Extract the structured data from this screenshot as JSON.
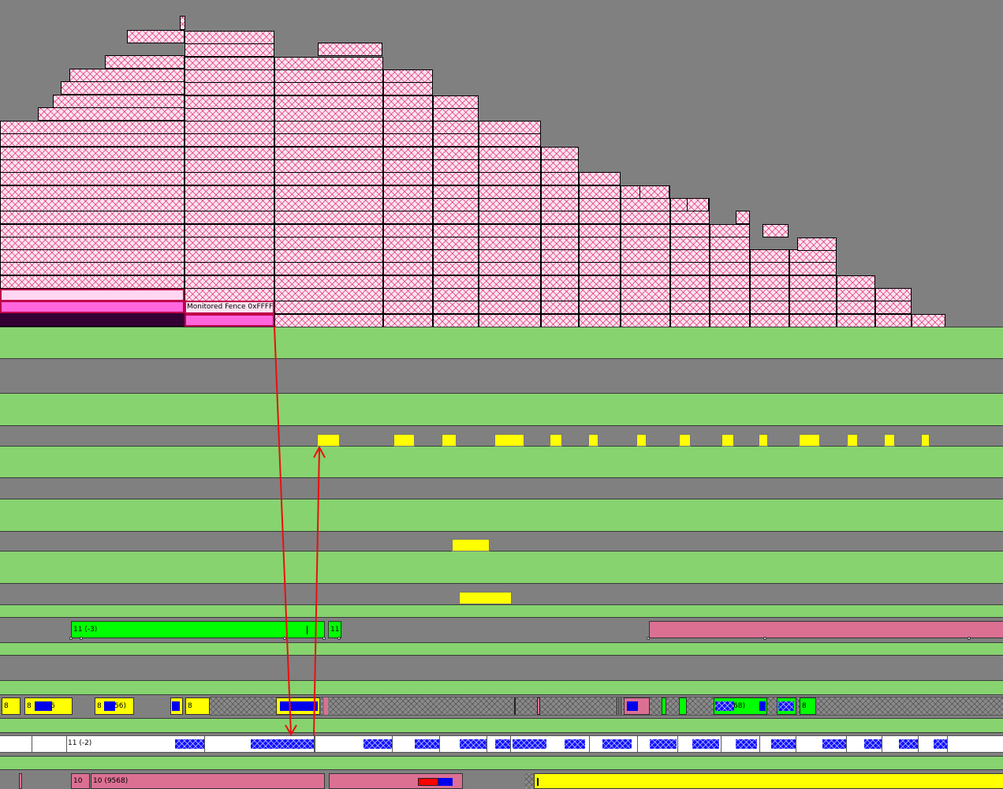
{
  "queue_graph": {
    "selected_packet_label": "Monitored Fence 0xFFFF"
  },
  "timeline_rows": {
    "hw_queue_block_1_label": "11 (-3)",
    "hw_queue_block_2_label": "11",
    "context_small_labels": [
      "8",
      "8",
      "8",
      "8"
    ],
    "context_label_2_suffix": "6",
    "context_label_3_suffix": "56)",
    "context_label_8_suffix": "68)",
    "context_label_9": "8",
    "white_row_label": "11 (-2)",
    "bottom_block_1_label": "10",
    "bottom_block_2_label": "10 (9568)"
  },
  "colors": {
    "background": "#808080",
    "lane_green": "#87d36f",
    "packet_fill": "#fbe3f3",
    "packet_hatch": "#dc0046",
    "dma_yellow": "#ffff00",
    "queue_green": "#00ff00",
    "queue_pink": "#db7093",
    "blue_packet": "#0000ee",
    "arrow_red": "#e81010",
    "selected_magenta": "#ff66dd",
    "selected_dark": "#330033"
  }
}
